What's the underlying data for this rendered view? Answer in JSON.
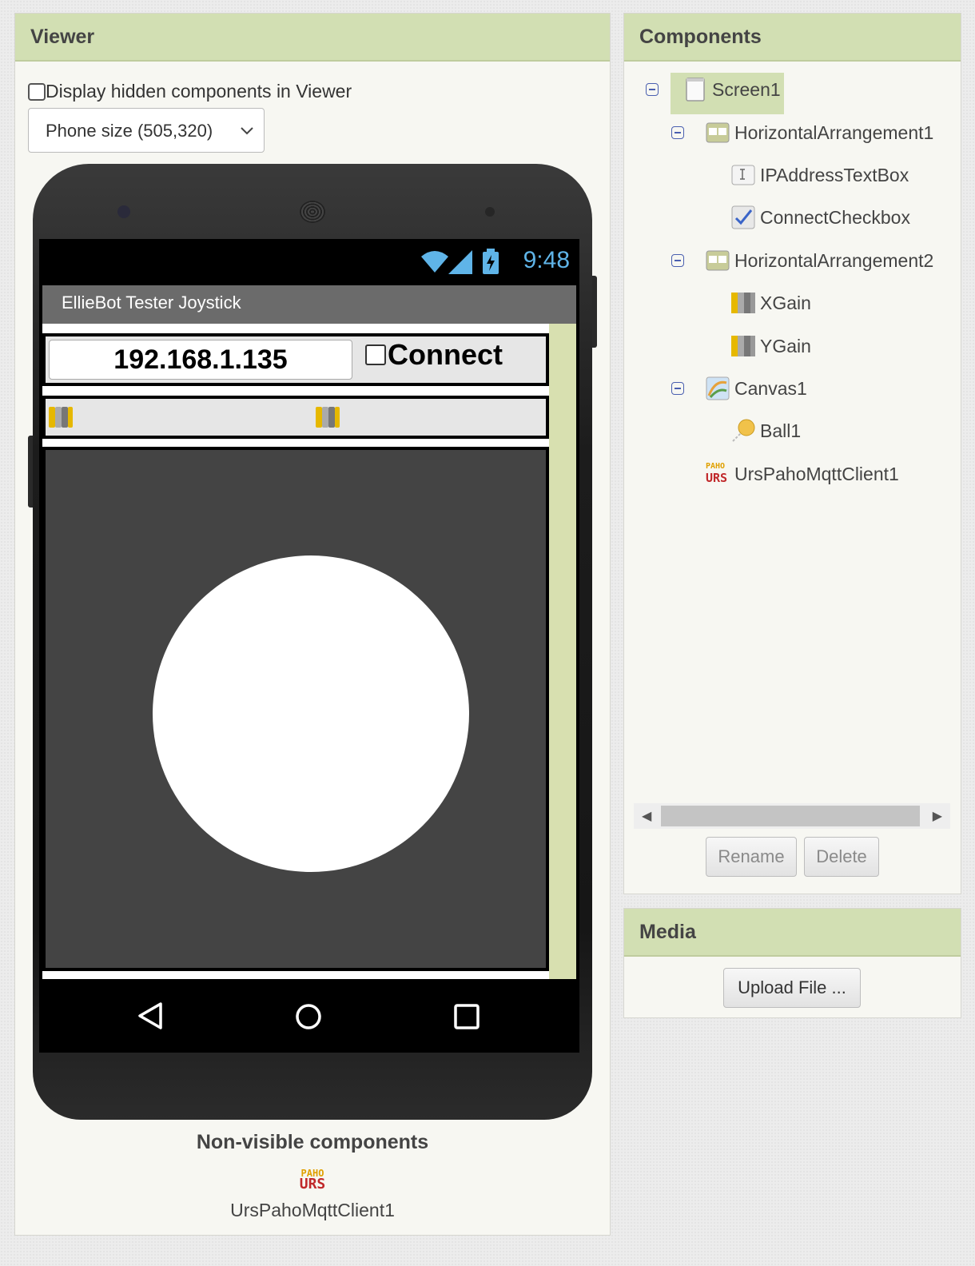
{
  "viewer": {
    "header": "Viewer",
    "hidden_checkbox_label": "Display hidden components in Viewer",
    "size_select_value": "Phone size (505,320)",
    "phone": {
      "clock": "9:48",
      "app_title": "EllieBot Tester Joystick",
      "ip_textbox_value": "192.168.1.135",
      "connect_label": "Connect"
    },
    "nonvisible_title": "Non-visible components",
    "nonvisible_icon_top": "PAHO",
    "nonvisible_icon_bottom": "URS",
    "nonvisible_item": "UrsPahoMqttClient1"
  },
  "components": {
    "header": "Components",
    "tree": [
      {
        "label": "Screen1",
        "icon": "screen-icon"
      },
      {
        "label": "HorizontalArrangement1",
        "icon": "horizontal-arrangement-icon"
      },
      {
        "label": "IPAddressTextBox",
        "icon": "textbox-icon"
      },
      {
        "label": "ConnectCheckbox",
        "icon": "checkbox-icon"
      },
      {
        "label": "HorizontalArrangement2",
        "icon": "horizontal-arrangement-icon"
      },
      {
        "label": "XGain",
        "icon": "slider-icon"
      },
      {
        "label": "YGain",
        "icon": "slider-icon"
      },
      {
        "label": "Canvas1",
        "icon": "canvas-icon"
      },
      {
        "label": "Ball1",
        "icon": "ball-icon"
      },
      {
        "label": "UrsPahoMqttClient1",
        "icon": "paho-icon"
      }
    ],
    "rename_label": "Rename",
    "delete_label": "Delete"
  },
  "media": {
    "header": "Media",
    "upload_label": "Upload File ..."
  },
  "colors": {
    "panel_header": "#d2dfb3",
    "status_blue": "#5fb4e8",
    "canvas_bg": "#444444",
    "tree_toggle": "#4a5fb0"
  }
}
